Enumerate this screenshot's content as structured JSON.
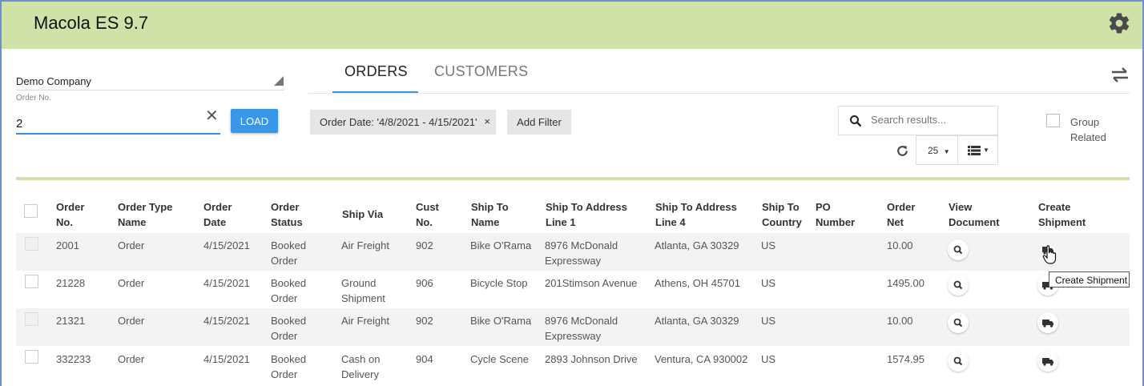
{
  "app": {
    "title": "Macola ES 9.7"
  },
  "sidebar": {
    "company": "Demo Company",
    "order_label": "Order No.",
    "order_value": "2",
    "load_label": "LOAD"
  },
  "tabs": [
    {
      "label": "ORDERS",
      "active": true
    },
    {
      "label": "CUSTOMERS",
      "active": false
    }
  ],
  "filters": {
    "chip_label": "Order Date: '4/8/2021 - 4/15/2021'",
    "chip_remove": "×",
    "add_filter_label": "Add Filter"
  },
  "search": {
    "placeholder": "Search results..."
  },
  "pagination": {
    "page_size": "25"
  },
  "group_related": {
    "line1": "Group",
    "line2": "Related"
  },
  "table": {
    "headers": [
      [
        "Order",
        "No."
      ],
      [
        "Order Type",
        "Name"
      ],
      [
        "Order",
        "Date"
      ],
      [
        "Order",
        "Status"
      ],
      [
        "Ship Via",
        ""
      ],
      [
        "Cust",
        "No."
      ],
      [
        "Ship To",
        "Name"
      ],
      [
        "Ship To Address",
        "Line 1"
      ],
      [
        "Ship To Address",
        "Line 4"
      ],
      [
        "Ship To",
        "Country"
      ],
      [
        "PO",
        "Number"
      ],
      [
        "Order",
        "Net"
      ],
      [
        "View",
        "Document"
      ],
      [
        "Create",
        "Shipment"
      ]
    ],
    "rows": [
      {
        "order_no": "2001",
        "type": "Order",
        "date": "4/15/2021",
        "status1": "Booked",
        "status2": "Order",
        "via1": "Air Freight",
        "via2": "",
        "cust": "902",
        "ship_name": "Bike O'Rama",
        "addr1a": "8976 McDonald",
        "addr1b": "Expressway",
        "addr4": "Atlanta, GA 30329",
        "country": "US",
        "po": "",
        "net": "10.00"
      },
      {
        "order_no": "21228",
        "type": "Order",
        "date": "4/15/2021",
        "status1": "Booked",
        "status2": "Order",
        "via1": "Ground",
        "via2": "Shipment",
        "cust": "906",
        "ship_name": "Bicycle Stop",
        "addr1a": "201Stimson Avenue",
        "addr1b": "",
        "addr4": "Athens, OH 45701",
        "country": "US",
        "po": "",
        "net": "1495.00"
      },
      {
        "order_no": "21321",
        "type": "Order",
        "date": "4/15/2021",
        "status1": "Booked",
        "status2": "Order",
        "via1": "Air Freight",
        "via2": "",
        "cust": "902",
        "ship_name": "Bike O'Rama",
        "addr1a": "8976 McDonald",
        "addr1b": "Expressway",
        "addr4": "Atlanta, GA 30329",
        "country": "US",
        "po": "",
        "net": "10.00"
      },
      {
        "order_no": "332233",
        "type": "Order",
        "date": "4/15/2021",
        "status1": "Booked",
        "status2": "Order",
        "via1": "Cash on",
        "via2": "Delivery",
        "cust": "904",
        "ship_name": "Cycle Scene",
        "addr1a": "2893 Johnson Drive",
        "addr1b": "",
        "addr4": "Ventura, CA 930002",
        "country": "US",
        "po": "",
        "net": "1574.95"
      }
    ]
  },
  "tooltip": "Create Shipment",
  "icons": {
    "settings": "gear-icon",
    "swap": "swap-arrows-icon",
    "search": "search-icon",
    "refresh": "refresh-icon",
    "view": "magnifier-icon",
    "shipment": "truck-icon"
  },
  "colors": {
    "header": "#cfe3a8",
    "accent": "#3a97e8"
  }
}
